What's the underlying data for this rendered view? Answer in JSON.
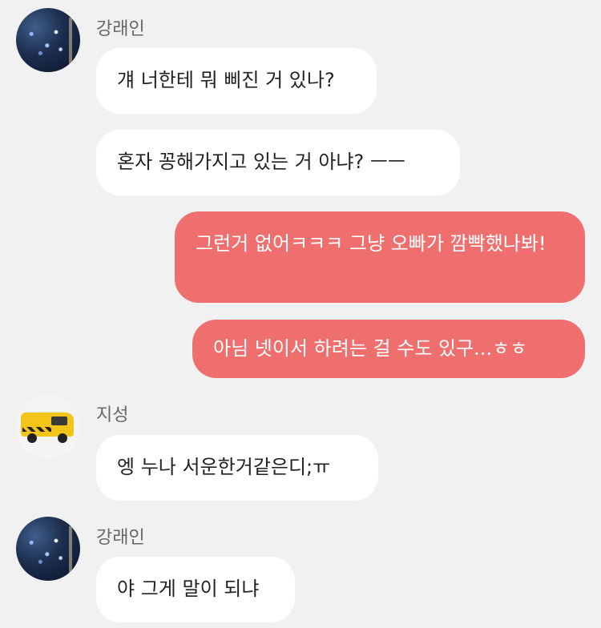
{
  "messages": [
    {
      "sender": "강래인",
      "text": "걔 너한테 뭐 삐진 거 있나?"
    },
    {
      "text": "혼자 꽁해가지고 있는 거 아냐? ㅡㅡ"
    },
    {
      "text": "그런거 없어ㅋㅋㅋ 그냥 오빠가 깜빡했나봐!"
    },
    {
      "text": "아님 넷이서 하려는 걸 수도 있구...ㅎㅎ"
    },
    {
      "sender": "지성",
      "text": "엥 누나 서운한거같은디;ㅠ"
    },
    {
      "sender": "강래인",
      "text": "야 그게 말이 되냐"
    }
  ],
  "colors": {
    "background": "#f1f1f1",
    "incoming_bubble": "#ffffff",
    "outgoing_bubble": "#ee6f6d"
  }
}
